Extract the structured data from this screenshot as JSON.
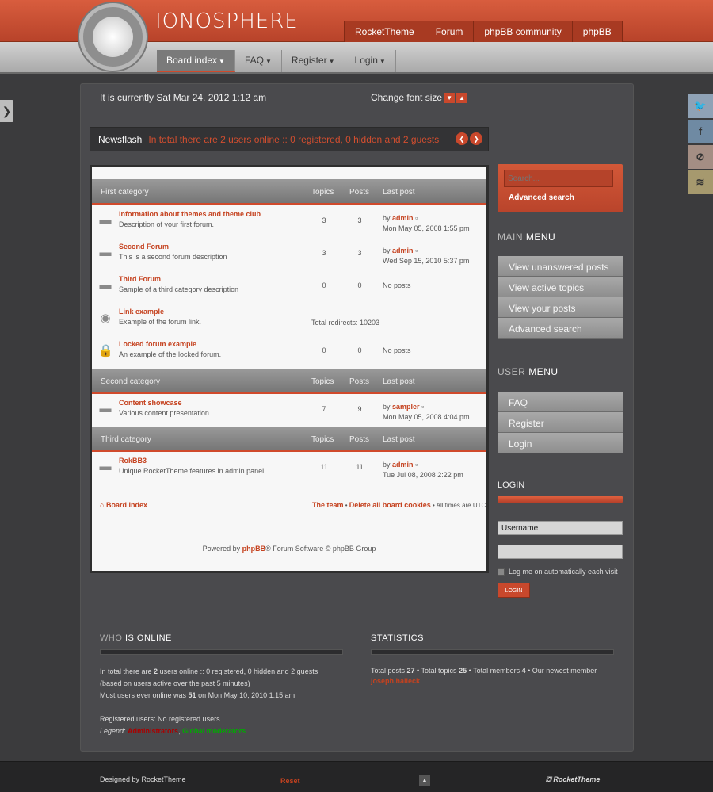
{
  "header": {
    "site_title": "IONOSPHERE",
    "top_links": [
      "RocketTheme",
      "Forum",
      "phpBB community",
      "phpBB"
    ],
    "nav": [
      {
        "label": "Board index",
        "active": true
      },
      {
        "label": "FAQ",
        "active": false
      },
      {
        "label": "Register",
        "active": false
      },
      {
        "label": "Login",
        "active": false
      }
    ]
  },
  "topbar": {
    "date": "It is currently Sat Mar 24, 2012 1:12 am",
    "font_size_label": "Change font size"
  },
  "newsflash": {
    "label": "Newsflash",
    "text": "In total there are 2 users online :: 0 registered, 0 hidden and 2 guests"
  },
  "categories": [
    {
      "name": "First category",
      "col_topics": "Topics",
      "col_posts": "Posts",
      "col_last": "Last post",
      "forums": [
        {
          "icon": "forum-icon",
          "name": "Information about themes and theme club",
          "desc": "Description of your first forum.",
          "topics": "3",
          "posts": "3",
          "last_by": "by",
          "last_user": "admin",
          "last_date": "Mon May 05, 2008 1:55 pm"
        },
        {
          "icon": "forum-icon",
          "name": "Second Forum",
          "desc": "This is a second forum description",
          "topics": "3",
          "posts": "3",
          "last_by": "by",
          "last_user": "admin",
          "last_date": "Wed Sep 15, 2010 5:37 pm"
        },
        {
          "icon": "forum-icon",
          "name": "Third Forum",
          "desc": "Sample of a third category description",
          "topics": "0",
          "posts": "0",
          "no_posts": "No posts"
        },
        {
          "icon": "eye-icon",
          "name": "Link example",
          "desc": "Example of the forum link.",
          "redirects": "Total redirects: 10203"
        },
        {
          "icon": "lock-icon",
          "name": "Locked forum example",
          "desc": "An example of the locked forum.",
          "topics": "0",
          "posts": "0",
          "no_posts": "No posts"
        }
      ]
    },
    {
      "name": "Second category",
      "col_topics": "Topics",
      "col_posts": "Posts",
      "col_last": "Last post",
      "forums": [
        {
          "icon": "forum-icon",
          "name": "Content showcase",
          "desc": "Various content presentation.",
          "topics": "7",
          "posts": "9",
          "last_by": "by",
          "last_user": "sampler",
          "last_date": "Mon May 05, 2008 4:04 pm"
        }
      ]
    },
    {
      "name": "Third category",
      "col_topics": "Topics",
      "col_posts": "Posts",
      "col_last": "Last post",
      "forums": [
        {
          "icon": "forum-icon",
          "name": "RokBB3",
          "desc": "Unique RocketTheme features in admin panel.",
          "topics": "11",
          "posts": "11",
          "last_by": "by",
          "last_user": "admin",
          "last_date": "Tue Jul 08, 2008 2:22 pm"
        }
      ]
    }
  ],
  "panel_footer": {
    "board_index": "Board index",
    "team": "The team",
    "sep": " • ",
    "delete_cookies": "Delete all board cookies",
    "times": " • All times are UTC"
  },
  "powered": {
    "prefix": "Powered by ",
    "brand": "phpBB",
    "suffix": "® Forum Software © phpBB Group"
  },
  "sidebar": {
    "search_placeholder": "Search...",
    "advanced_search": "Advanced search",
    "main_menu_prefix": "MAIN",
    "main_menu_word": "MENU",
    "main_menu": [
      "View unanswered posts",
      "View active topics",
      "View your posts",
      "Advanced search"
    ],
    "user_menu_prefix": "USER",
    "user_menu_word": "MENU",
    "user_menu": [
      "FAQ",
      "Register",
      "Login"
    ],
    "login_title": "LOGIN",
    "username_value": "Username",
    "password_value": "",
    "remember": "Log me on automatically each visit",
    "login_button": "LOGIN"
  },
  "who_online": {
    "title_prefix": "WHO",
    "title_word": "IS ONLINE",
    "line1_a": "In total there are ",
    "line1_b": "2",
    "line1_c": " users online :: 0 registered, 0 hidden and 2 guests",
    "line2": "(based on users active over the past 5 minutes)",
    "line3_a": "Most users ever online was ",
    "line3_b": "51",
    "line3_c": " on Mon May 10, 2010 1:15 am",
    "line4": "Registered users: No registered users",
    "legend_label": "Legend: ",
    "legend_admin": "Administrators",
    "legend_sep": ", ",
    "legend_mod": "Global moderators"
  },
  "statistics": {
    "title": "STATISTICS",
    "a": "Total posts ",
    "b": "27",
    "c": " • Total topics ",
    "d": "25",
    "e": " • Total members ",
    "f": "4",
    "g": " • Our newest member",
    "newest": "joseph.halleck"
  },
  "footer": {
    "designed": "Designed by RocketTheme",
    "reset": "Reset",
    "logo": "RocketTheme"
  },
  "colors": {
    "accent": "#c9482c",
    "header": "#c34e33",
    "body": "#3b3b3d"
  }
}
